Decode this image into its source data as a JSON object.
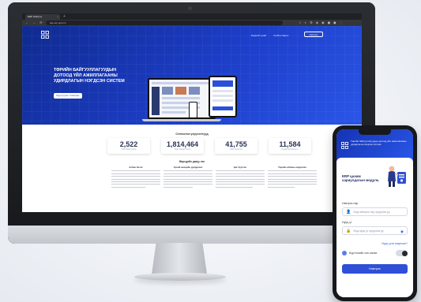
{
  "browser": {
    "tab_title": "ERP Нэвтрэх",
    "tab_close": "×",
    "new_tab": "+",
    "nav_icons": "← → ⟳",
    "url": "app.erp.gov.mn",
    "ext_icons": "☆ ◐ ⚙ ◈ ◉ ◼ ◼ ⋮"
  },
  "site": {
    "nav": [
      "Бидний тухай",
      "Холбоо барих"
    ],
    "login_label": "Нэвтрэх",
    "hero_title_lines": [
      "ТӨРИЙН БАЙГУУЛЛАГУУДЫН",
      "ДОТООД ҮЙЛ АЖИЛЛАГААНЫ",
      "УДИРДЛАГЫН НЭГДСЭН СИСТЕМ"
    ],
    "hero_button": "Бүртгүүлэх / Нэвтрэх",
    "stats_title": "Статистик үзүүлэлтүүд",
    "stats": [
      {
        "value": "2,522",
        "label": "Нийт байгууллага"
      },
      {
        "value": "1,814,464",
        "label": "Нийт баримт бичиг"
      },
      {
        "value": "41,755",
        "label": "Нийт хэрэглэгч"
      },
      {
        "value": "11,584",
        "label": "Идэвхтэй хэрэглэгч"
      }
    ],
    "about_title": "Өөрсдийн давуу тал",
    "columns": [
      {
        "heading": "Албан бичиг"
      },
      {
        "heading": "Хүний нөөцийн удирдлага"
      },
      {
        "heading": "Цаг бүртгэл"
      },
      {
        "heading": "Төрийн албаны мэдээлэл"
      }
    ]
  },
  "phone": {
    "header_text": "Төрийн байгууллагуудын дотоод үйл ажиллагааны удирдлагын нэгдсэн систем",
    "title": "ERP цахим хариулдагын модуль",
    "username_label": "Нэвтрэх нэр",
    "username_placeholder": "Энд нэвтрэх нэр оруулна уу",
    "password_label": "Нууц үг",
    "password_placeholder": "Энд нууц үг оруулна уу",
    "forgot_label": "Нууц үгээ мартсан?",
    "remember_label": "Бүртгэлийг хэн санах",
    "submit_label": "Нэвтрэх",
    "user_icon": "user-icon",
    "lock_icon": "lock-icon",
    "eye_icon": "eye-icon"
  },
  "colors": {
    "primary": "#2f4fd6",
    "hero_dark": "#0f2a8f",
    "device_frame": "#17181b"
  }
}
